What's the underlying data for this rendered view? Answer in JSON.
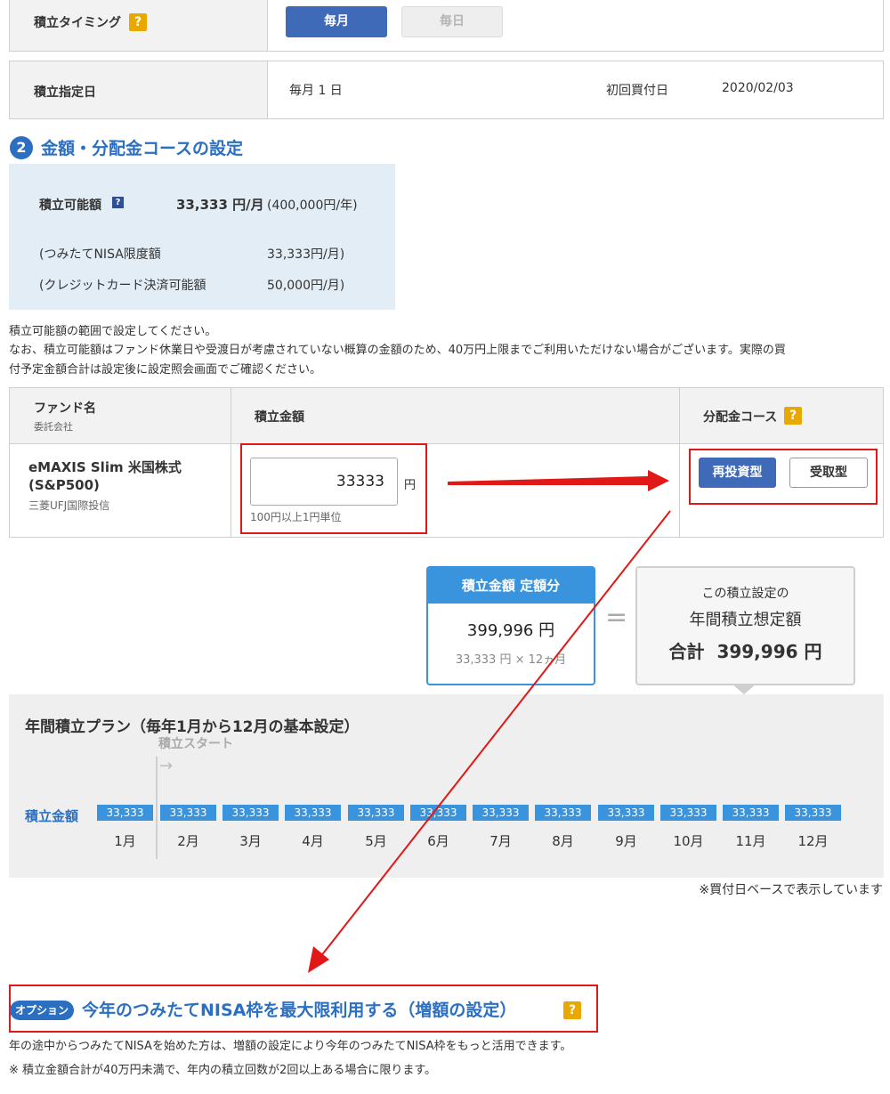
{
  "timing": {
    "label": "積立タイミング",
    "help": "?",
    "monthly_label": "毎月",
    "daily_label": "毎日"
  },
  "date_row": {
    "label": "積立指定日",
    "value": "毎月 1 日",
    "first_purchase_label": "初回買付日",
    "first_purchase_date": "2020/02/03"
  },
  "section2": {
    "number": "2",
    "title": "金額・分配金コースの設定"
  },
  "available": {
    "label": "積立可能額",
    "amount": "33,333 円/月",
    "annual": "(400,000円/年)",
    "nisa_limit_label": "(つみたてNISA限度額",
    "nisa_limit_value": "33,333円/月)",
    "card_limit_label": "(クレジットカード決済可能額",
    "card_limit_value": "50,000円/月)"
  },
  "notes": {
    "line1": "積立可能額の範囲で設定してください。",
    "line2": "なお、積立可能額はファンド休業日や受渡日が考慮されていない概算の金額のため、40万円上限までご利用いただけない場合がございます。実際の買",
    "line3": "付予定金額合計は設定後に設定照会画面でご確認ください。"
  },
  "fund_table": {
    "col_fund": "ファンド名",
    "col_fund_sub": "委託会社",
    "col_amount": "積立金額",
    "col_course": "分配金コース",
    "help": "?",
    "fund_name_1": "eMAXIS Slim 米国株式",
    "fund_name_2": "(S&P500)",
    "company": "三菱UFJ国際投信",
    "amount_value": "33333",
    "amount_unit": "円",
    "amount_hint": "100円以上1円単位",
    "reinvest_label": "再投資型",
    "receive_label": "受取型"
  },
  "summary": {
    "card_title": "積立金額 定額分",
    "card_value": "399,996 円",
    "card_formula": "33,333 円 × 12ヵ月",
    "equals": "=",
    "total_line1": "この積立設定の",
    "total_line2": "年間積立想定額",
    "total_prefix": "合計",
    "total_value": "399,996 円"
  },
  "plan": {
    "title": "年間積立プラン（毎年1月から12月の基本設定）",
    "start_label": "積立スタート",
    "start_arrow": "→",
    "row_label": "積立金額",
    "amounts": [
      "33,333",
      "33,333",
      "33,333",
      "33,333",
      "33,333",
      "33,333",
      "33,333",
      "33,333",
      "33,333",
      "33,333",
      "33,333",
      "33,333"
    ],
    "months": [
      "1月",
      "2月",
      "3月",
      "4月",
      "5月",
      "6月",
      "7月",
      "8月",
      "9月",
      "10月",
      "11月",
      "12月"
    ],
    "footnote": "※買付日ベースで表示しています"
  },
  "option": {
    "badge": "オプション",
    "title": "今年のつみたてNISA枠を最大限利用する（増額の設定）",
    "help": "?",
    "desc1": "年の途中からつみたてNISAを始めた方は、増額の設定により今年のつみたてNISA枠をもっと活用できます。",
    "desc2": "※ 積立金額合計が40万円未満で、年内の積立回数が2回以上ある場合に限ります。"
  },
  "colors": {
    "accent_blue": "#2b6fc2",
    "bar_blue": "#3a93dd",
    "button_blue": "#3f6ab7",
    "help_orange": "#e8a800",
    "annotation_red": "#e01818"
  }
}
